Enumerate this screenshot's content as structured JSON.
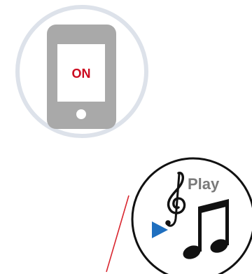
{
  "phone": {
    "screen_label": "ON",
    "icon": "smartphone-icon"
  },
  "music": {
    "label": "Play",
    "icons": [
      "treble-clef-icon",
      "eighth-notes-icon",
      "play-triangle-icon"
    ]
  },
  "colors": {
    "ring": "#dde2ea",
    "phone_body": "#a9a9a9",
    "screen": "#ffffff",
    "on_text": "#cc0a1f",
    "circle_border": "#111111",
    "play_text": "#7a7a7a",
    "play_triangle": "#1f6fbf",
    "pointer_line": "#d9262f"
  }
}
